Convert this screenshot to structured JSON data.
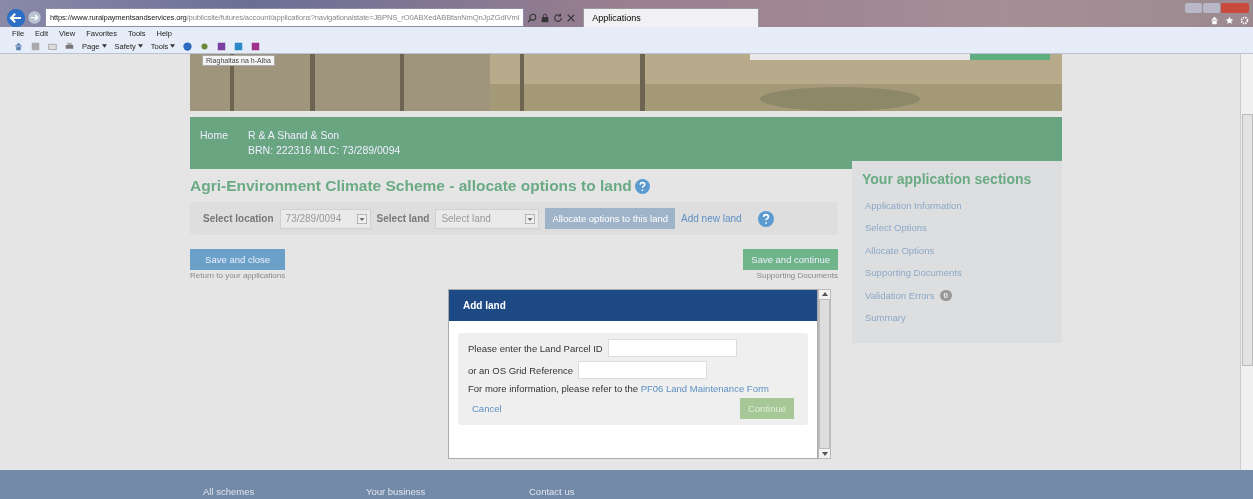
{
  "browser": {
    "address_host": "https://www.ruralpaymentsandservices.org",
    "address_path": "/publicsite/futures/account/applications?navigationalstate=JBPNS_rO0ABXedABBfanNmQnJpZGdIVml",
    "tab": {
      "title": "Applications"
    },
    "menu": [
      "File",
      "Edit",
      "View",
      "Favorites",
      "Tools",
      "Help"
    ],
    "commands": [
      "Page",
      "Safety",
      "Tools"
    ]
  },
  "banner": {
    "tooltip": "Riaghaltas na h-Alba"
  },
  "breadcrumb": {
    "home": "Home",
    "business_name": "R & A Shand & Son",
    "business_ids": "BRN: 222316 MLC: 73/289/0094"
  },
  "page_title": "Agri-Environment Climate Scheme - allocate options to land",
  "toolbar": {
    "location_label": "Select location",
    "location_value": "73/289/0094",
    "land_label": "Select land",
    "land_placeholder": "Select land",
    "allocate_button": {
      "label": "Allocate options to this land",
      "disabled": true
    },
    "add_land_link": "Add new land"
  },
  "actions": {
    "save_close": {
      "label": "Save and close",
      "caption": "Return to your applications"
    },
    "save_continue": {
      "label": "Save and continue",
      "caption": "Supporting Documents"
    }
  },
  "sidebar": {
    "title": "Your application sections",
    "items": [
      {
        "label": "Application Information"
      },
      {
        "label": "Select Options"
      },
      {
        "label": "Allocate Options"
      },
      {
        "label": "Supporting Documents"
      },
      {
        "label": "Validation Errors",
        "badge": "0"
      },
      {
        "label": "Summary"
      }
    ]
  },
  "dialog": {
    "title": "Add land",
    "parcel_label": "Please enter the Land Parcel ID",
    "grid_label": "or an OS Grid Reference",
    "info_text": "For more information, please refer to the",
    "info_link": "PF06 Land Maintenance Form",
    "cancel": "Cancel",
    "continue": {
      "label": "Continue",
      "disabled": true
    }
  },
  "footer": [
    "All schemes",
    "Your business",
    "Contact us"
  ]
}
